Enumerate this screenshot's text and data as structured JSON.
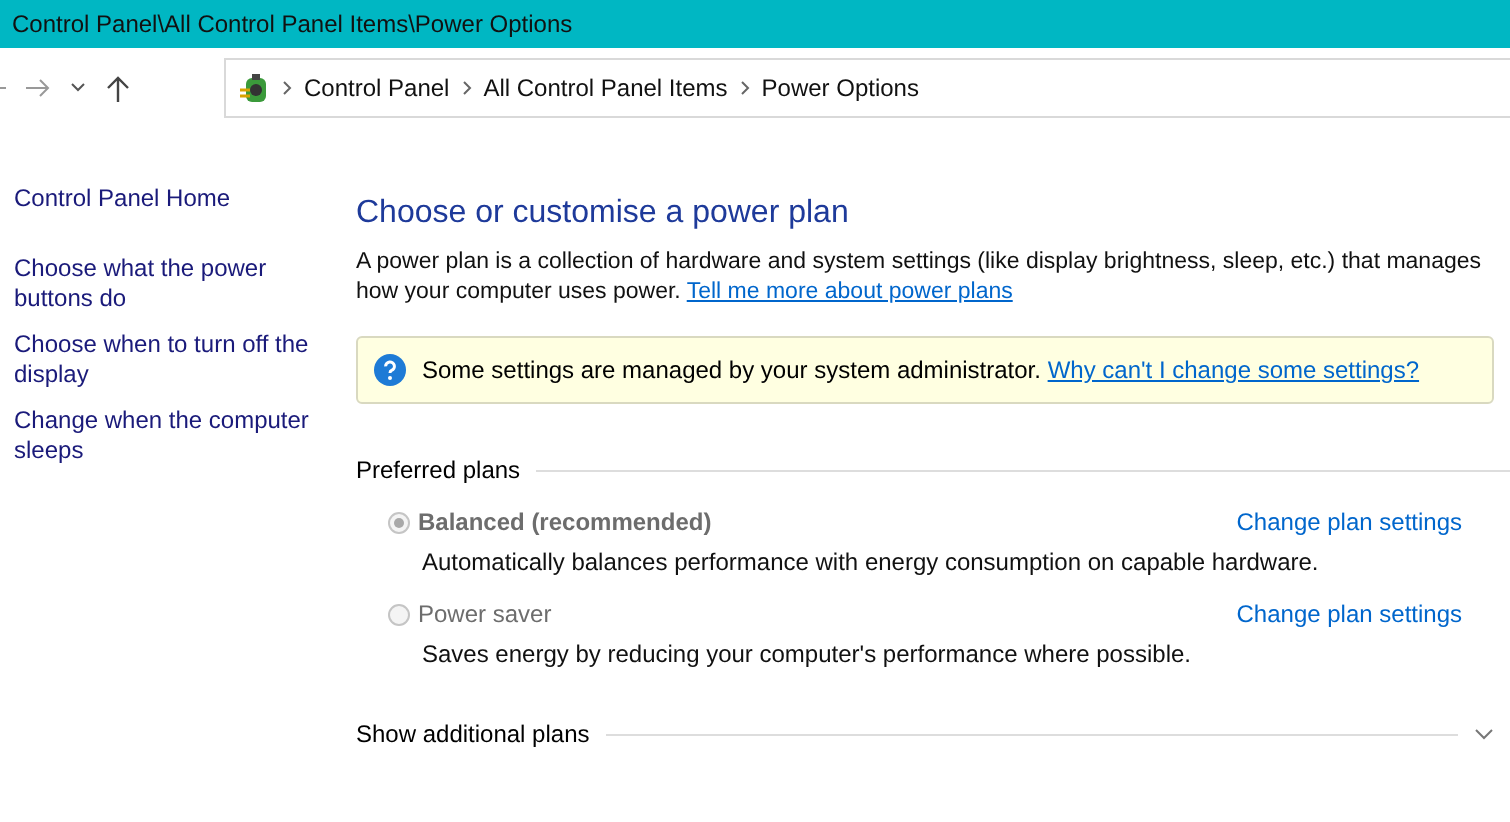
{
  "window": {
    "title": "Control Panel\\All Control Panel Items\\Power Options"
  },
  "address_bar": {
    "crumbs": [
      "Control Panel",
      "All Control Panel Items",
      "Power Options"
    ]
  },
  "sidebar": {
    "home": "Control Panel Home",
    "links": [
      "Choose what the power buttons do",
      "Choose when to turn off the display",
      "Change when the computer sleeps"
    ]
  },
  "main": {
    "heading": "Choose or customise a power plan",
    "description": "A power plan is a collection of hardware and system settings (like display brightness, sleep, etc.) that manages how your computer uses power.",
    "description_link": "Tell me more about power plans",
    "notice": {
      "text": "Some settings are managed by your system administrator.",
      "link": "Why can't I change some settings?"
    },
    "preferred_plans": {
      "title": "Preferred plans",
      "plans": [
        {
          "name": "Balanced (recommended)",
          "selected": true,
          "disabled": true,
          "description": "Automatically balances performance with energy consumption on capable hardware.",
          "link": "Change plan settings"
        },
        {
          "name": "Power saver",
          "selected": false,
          "disabled": true,
          "description": "Saves energy by reducing your computer's performance where possible.",
          "link": "Change plan settings"
        }
      ]
    },
    "additional_plans": {
      "title": "Show additional plans",
      "expanded": false
    }
  }
}
